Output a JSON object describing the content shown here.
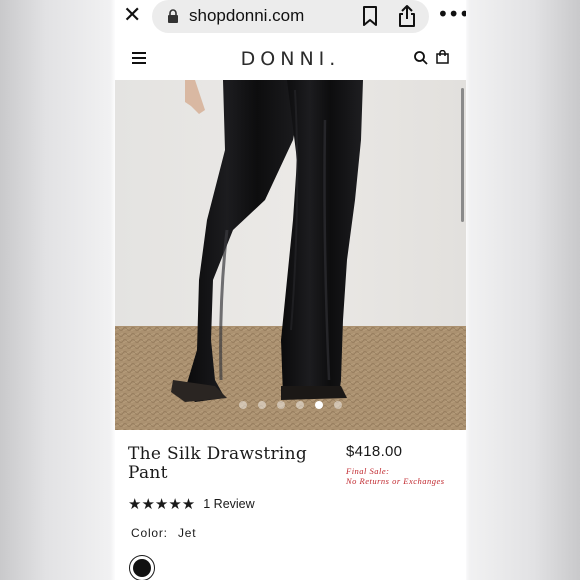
{
  "browser": {
    "url": "shopdonni.com",
    "icons": [
      "close-icon",
      "lock-icon",
      "bookmark-icon",
      "share-icon",
      "more-icon"
    ]
  },
  "header": {
    "brand": "DONNI.",
    "icons": [
      "menu-icon",
      "search-icon",
      "cart-icon"
    ]
  },
  "gallery": {
    "image_count": 6,
    "active_index": 4
  },
  "product": {
    "title": "The Silk Drawstring Pant",
    "price": "$418.00",
    "final_sale_line1": "Final Sale:",
    "final_sale_line2": "No Returns or Exchanges",
    "stars": "★★★★★",
    "rating": 5,
    "review_count": "1 Review",
    "color_label": "Color:",
    "color_value": "Jet"
  },
  "colors": {
    "final_sale": "#c0272d",
    "swatch_jet": "#111111",
    "text": "#1a1a1a"
  }
}
